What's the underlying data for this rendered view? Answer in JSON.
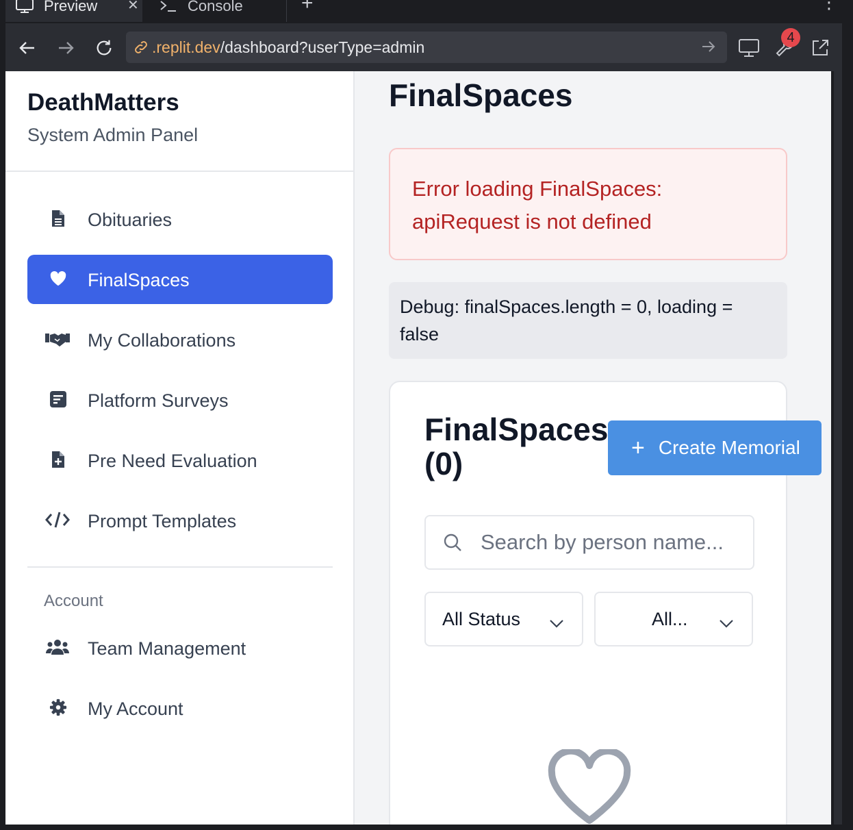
{
  "browser": {
    "tabs": [
      {
        "label": "Preview",
        "icon": "monitor-icon",
        "active": true
      },
      {
        "label": "Console",
        "icon": "terminal-icon",
        "active": false
      }
    ],
    "url": {
      "host": ".replit.dev",
      "path": "/dashboard?userType=admin"
    },
    "notification_count": "4"
  },
  "sidebar": {
    "brand": "DeathMatters",
    "subtitle": "System Admin Panel",
    "items": [
      {
        "label": "Obituaries",
        "icon": "document-icon"
      },
      {
        "label": "FinalSpaces",
        "icon": "heart-icon",
        "active": true
      },
      {
        "label": "My Collaborations",
        "icon": "handshake-icon"
      },
      {
        "label": "Platform Surveys",
        "icon": "survey-icon"
      },
      {
        "label": "Pre Need Evaluation",
        "icon": "file-plus-icon"
      },
      {
        "label": "Prompt Templates",
        "icon": "code-icon"
      }
    ],
    "account_label": "Account",
    "account_items": [
      {
        "label": "Team Management",
        "icon": "users-icon"
      },
      {
        "label": "My Account",
        "icon": "gear-icon"
      }
    ]
  },
  "main": {
    "title": "FinalSpaces",
    "error": "Error loading FinalSpaces: apiRequest is not defined",
    "debug": "Debug: finalSpaces.length = 0, loading = false",
    "card": {
      "title": "FinalSpaces (0)",
      "create_label": "Create Memorial",
      "search_placeholder": "Search by person name...",
      "status_select": "All Status",
      "type_select": "All..."
    }
  },
  "colors": {
    "accent": "#3b62e6",
    "create_button": "#4a90e2",
    "error_text": "#b42323",
    "url_host": "#f1b26b",
    "badge": "#e5484d"
  }
}
